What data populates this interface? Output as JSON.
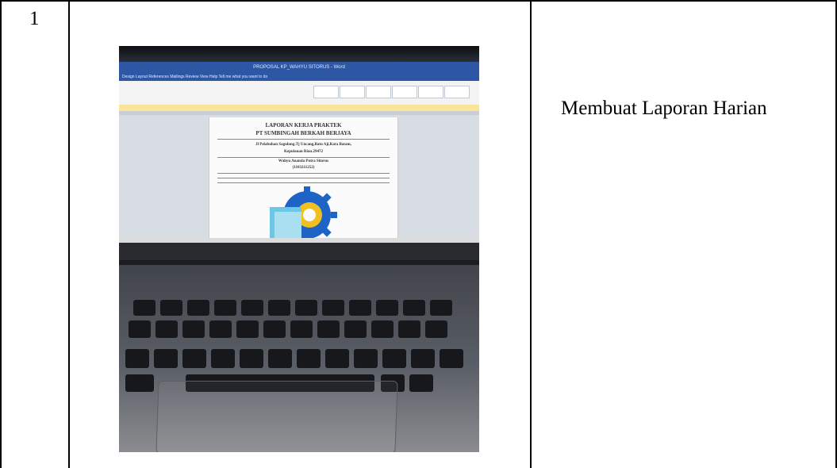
{
  "row": {
    "number": "1",
    "description": "Membuat Laporan Harian"
  },
  "photo": {
    "window_title": "PROPOSAL KP_WAHYU SITORUS - Word",
    "menu": "Design   Layout   References   Mailings   Review   View   Help   Tell me what you want to do",
    "doc_title": "LAPORAN KERJA PRAKTEK",
    "doc_company": "PT SUMBINGAH BERKAH BERJAYA",
    "doc_address_1": "Jl Pelabuhan Sagulung.Tj Uncang,Batu Aji,Kota Batam,",
    "doc_address_2": "Kepulauan Riau.29472",
    "doc_author": "Wahyu Ananda Putra Sitorus",
    "doc_id": "(1103211252)",
    "colors": {
      "word_blue": "#2d56a4",
      "logo_blue": "#1e63c6",
      "logo_yellow": "#f0c020",
      "logo_cyan": "#6cc7e6"
    }
  }
}
